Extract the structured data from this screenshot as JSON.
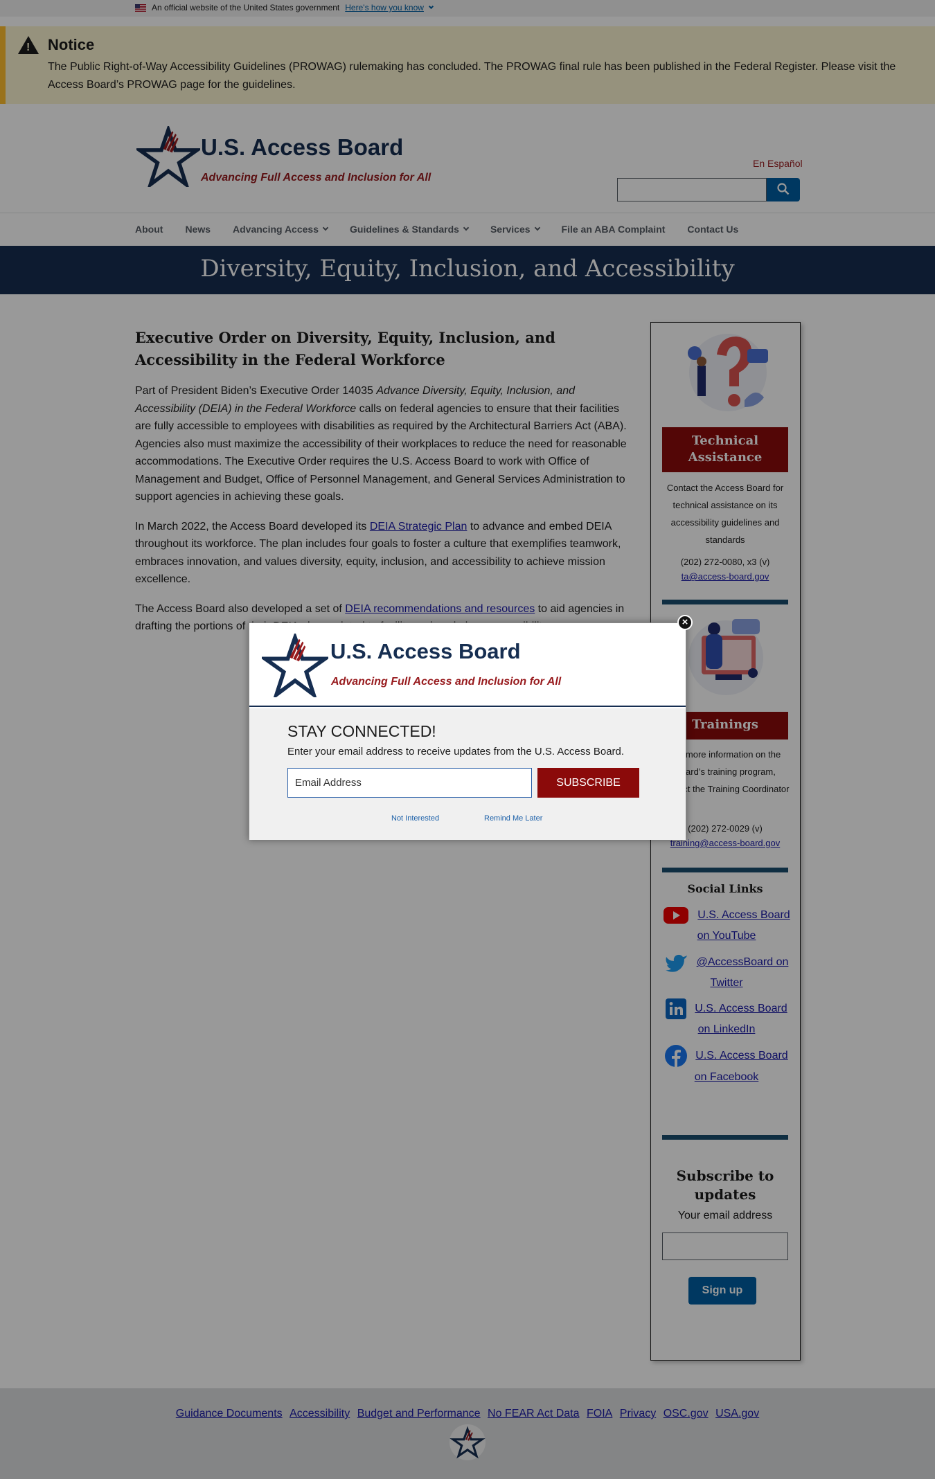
{
  "gov_banner": {
    "text": "An official website of the United States government",
    "link": "Here's how you know"
  },
  "notice": {
    "title": "Notice",
    "body": "The Public Right-of-Way Accessibility Guidelines (PROWAG) rulemaking has concluded. The PROWAG final rule has been published in the Federal Register. Please visit the Access Board’s PROWAG page for the guidelines."
  },
  "header": {
    "title": "U.S. Access Board",
    "tagline": "Advancing Full Access and Inclusion for All",
    "espanol": "En Español",
    "search_value": ""
  },
  "nav": [
    {
      "label": "About",
      "dropdown": false
    },
    {
      "label": "News",
      "dropdown": false
    },
    {
      "label": "Advancing Access",
      "dropdown": true
    },
    {
      "label": "Guidelines & Standards",
      "dropdown": true
    },
    {
      "label": "Services",
      "dropdown": true
    },
    {
      "label": "File an ABA Complaint",
      "dropdown": false
    },
    {
      "label": "Contact Us",
      "dropdown": false
    }
  ],
  "hero": {
    "title": "Diversity, Equity, Inclusion, and Accessibility"
  },
  "main": {
    "heading": "Executive Order on Diversity, Equity, Inclusion, and Accessibility in the Federal Workforce",
    "p1_a": "Part of President Biden’s Executive Order 14035 ",
    "p1_em": "Advance Diversity, Equity, Inclusion, and Accessibility (DEIA) in the Federal Workforce",
    "p1_b": " calls on federal agencies to ensure that their facilities are fully accessible to employees with disabilities as required by the Architectural Barriers Act (ABA). Agencies also must maximize the accessibility of their workplaces to reduce the need for reasonable accommodations. The Executive Order requires the U.S. Access Board to work with Office of Management and Budget, Office of Personnel Management, and General Services Administration to support agencies in achieving these goals.",
    "p2_a": "In March 2022, the Access Board developed its ",
    "p2_link": "DEIA Strategic Plan",
    "p2_b": " to advance and embed DEIA throughout its workforce. The plan includes four goals to foster a culture that exemplifies teamwork, embraces innovation, and values diversity, equity, inclusion, and accessibility to achieve mission excellence.",
    "p3_a": "The Access Board also developed a set of ",
    "p3_link": "DEIA recommendations and resources",
    "p3_b": " to aid agencies in drafting the portions of their DEIA plans related to facility and workplace accessibility."
  },
  "sidebar": {
    "tech": {
      "heading": "Technical Assistance",
      "text": "Contact the Access Board for technical assistance on its accessibility guidelines and standards",
      "phone": "(202) 272-0080, x3 (v)",
      "email": "ta@access-board.gov"
    },
    "training": {
      "heading": "Trainings",
      "text": "For more information on the Board’s training program, contact the Training Coordinator",
      "phone": "(202) 272-0029 (v)",
      "email": "training@access-board.gov"
    },
    "social_title": "Social Links",
    "social": [
      {
        "icon": "youtube-icon",
        "label": "U.S. Access Board on YouTube"
      },
      {
        "icon": "twitter-icon",
        "label": "@AccessBoard on Twitter"
      },
      {
        "icon": "linkedin-icon",
        "label": "U.S. Access Board on LinkedIn"
      },
      {
        "icon": "facebook-icon",
        "label": "U.S. Access Board on Facebook"
      }
    ],
    "subscribe": {
      "title": "Subscribe to updates",
      "label": "Your email address",
      "button": "Sign up"
    }
  },
  "footer": {
    "links": [
      "Guidance Documents",
      "Accessibility",
      "Budget and Performance",
      "No FEAR Act Data",
      "FOIA",
      "Privacy",
      "OSC.gov",
      "USA.gov"
    ]
  },
  "modal": {
    "title": "U.S. Access Board",
    "tagline": "Advancing Full Access and Inclusion for All",
    "heading": "STAY CONNECTED!",
    "description": "Enter your email address to receive updates from the U.S. Access Board.",
    "email_placeholder": "Email Address",
    "subscribe_button": "SUBSCRIBE",
    "not_interested": "Not Interested",
    "remind_later": "Remind Me Later"
  },
  "colors": {
    "navy": "#162e51",
    "red": "#981b1e",
    "maroon": "#8b0a0a",
    "link": "#1a1aa6",
    "notice_bg": "#faf3d1",
    "notice_border": "#ffbe2e"
  }
}
